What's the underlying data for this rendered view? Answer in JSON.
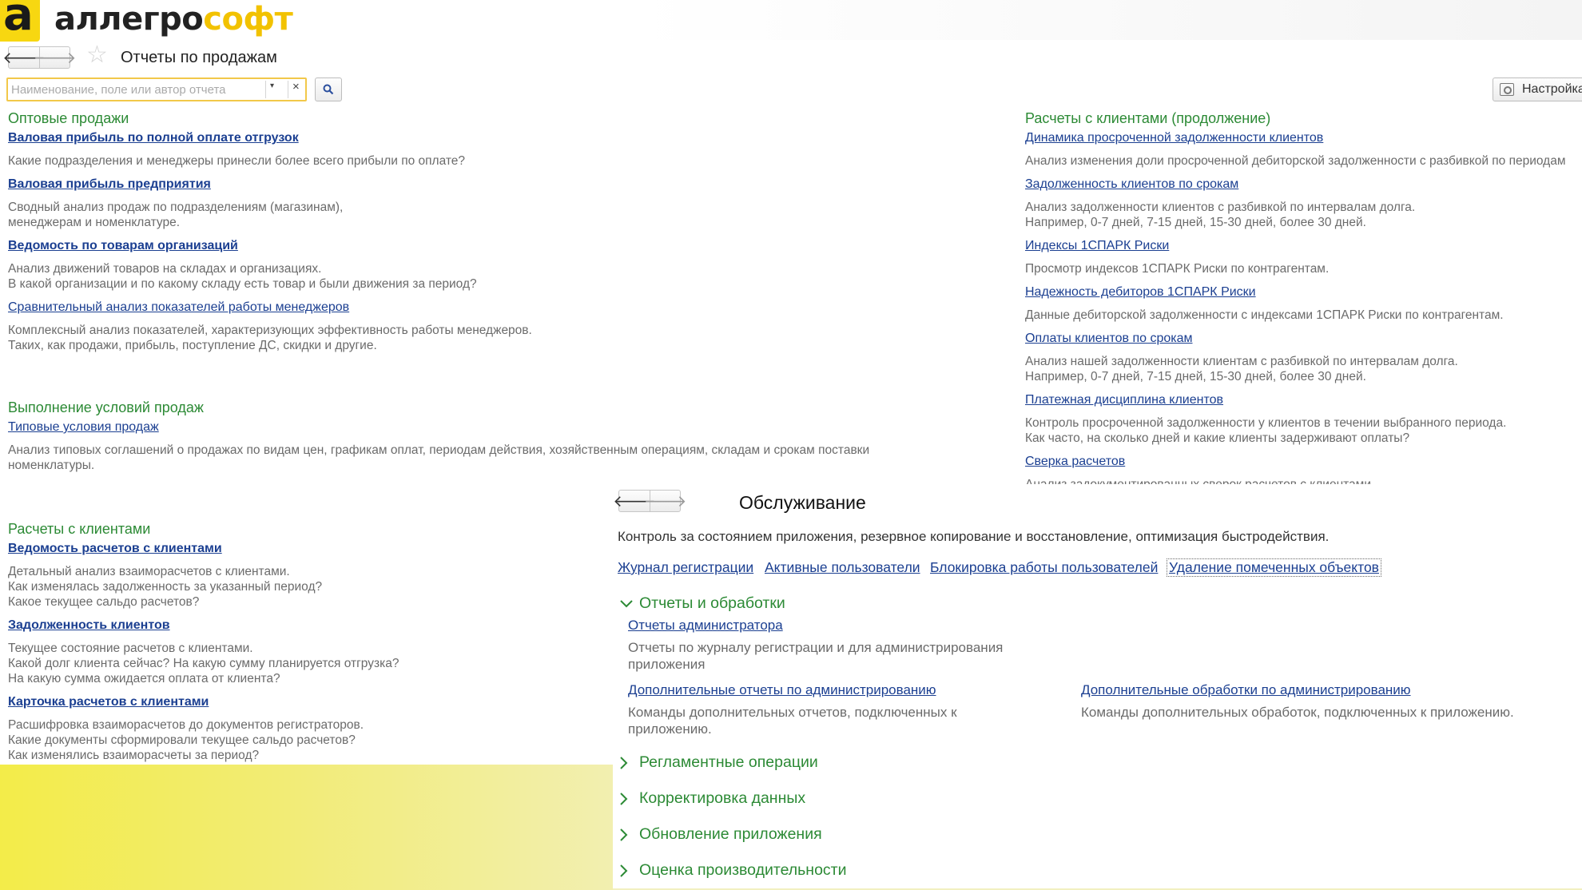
{
  "logo": {
    "mark": "а",
    "text_dark": "аллегро",
    "text_yellow": "софт"
  },
  "header": {
    "title": "Отчеты по продажам",
    "back_glyph": "🡐",
    "forward_glyph": "🡒",
    "star_glyph": "☆"
  },
  "search": {
    "placeholder": "Наименование, поле или автор отчета",
    "value": "",
    "dropdown_glyph": "▾",
    "clear_glyph": "×",
    "settings_label": "Настройка"
  },
  "sections": {
    "wholesale": {
      "heading": "Оптовые продажи",
      "items": [
        {
          "label": "Валовая прибыль по полной оплате отгрузок",
          "desc": [
            "Какие подразделения и менеджеры принесли более всего прибыли по оплате?"
          ]
        },
        {
          "label": "Валовая прибыль предприятия",
          "desc": [
            "Сводный анализ продаж по подразделениям (магазинам),",
            "менеджерам и номенклатуре."
          ]
        },
        {
          "label": "Ведомость по товарам организаций",
          "desc": [
            "Анализ движений товаров на складах и организациях.",
            "В какой организации и по какому складу есть товар и были движения за период?"
          ]
        },
        {
          "label": "Сравнительный анализ показателей работы менеджеров",
          "desc": [
            "Комплексный анализ показателей, характеризующих эффективность работы менеджеров.",
            "Таких, как продажи, прибыль, поступление ДС, скидки и другие."
          ]
        }
      ]
    },
    "conditions": {
      "heading": "Выполнение условий продаж",
      "items": [
        {
          "label": "Типовые условия продаж",
          "desc": [
            "Анализ типовых соглашений о продажах по видам цен, графикам оплат, периодам действия, хозяйственным операциям, складам и срокам поставки",
            "номенклатуры."
          ]
        }
      ]
    },
    "clients": {
      "heading": "Расчеты с клиентами",
      "items": [
        {
          "label": "Ведомость расчетов с клиентами",
          "desc": [
            "Детальный анализ взаиморасчетов с клиентами.",
            "Как изменялась задолженность за указанный период?",
            "Какое текущее сальдо расчетов?"
          ]
        },
        {
          "label": "Задолженность клиентов",
          "desc": [
            "Текущее состояние расчетов с клиентами.",
            "Какой долг клиента сейчас? На какую сумму планируется отгрузка?",
            "На какую сумма ожидается оплата от клиента?"
          ]
        },
        {
          "label": "Карточка расчетов с клиентами",
          "desc": [
            "Расшифровка взаиморасчетов до документов регистраторов.",
            "Какие документы сформировали текущее сальдо расчетов?",
            "Как изменялись взаиморасчеты за период?"
          ]
        }
      ]
    },
    "clients_cont": {
      "heading": "Расчеты с клиентами (продолжение)",
      "items": [
        {
          "label": "Динамика просроченной задолженности клиентов",
          "desc": [
            "Анализ изменения доли просроченной дебиторской задолженности с разбивкой по периодам"
          ]
        },
        {
          "label": "Задолженность клиентов по срокам",
          "desc": [
            "Анализ задолженности клиентов с разбивкой по интервалам долга.",
            "Например, 0-7 дней, 7-15 дней, 15-30 дней, более 30 дней."
          ]
        },
        {
          "label": "Индексы 1СПАРК Риски",
          "desc": [
            "Просмотр индексов 1СПАРК Риски по контрагентам."
          ]
        },
        {
          "label": "Надежность дебиторов 1СПАРК Риски",
          "desc": [
            "Данные дебиторской задолженности с индексами 1СПАРК Риски по контрагентам."
          ]
        },
        {
          "label": "Оплаты клиентов по срокам",
          "desc": [
            "Анализ нашей задолженности клиентам с разбивкой по интервалам долга.",
            "Например, 0-7 дней, 7-15 дней, 15-30 дней, более 30 дней."
          ]
        },
        {
          "label": "Платежная дисциплина клиентов",
          "desc": [
            "Контроль просроченной задолженности у клиентов в течении выбранного периода.",
            "Как часто, на сколько дней и какие клиенты задерживают оплаты?"
          ]
        },
        {
          "label": "Сверка расчетов",
          "desc": [
            "Анализ задокументированных сверок расчетов с клиентами"
          ]
        }
      ]
    }
  },
  "service": {
    "title": "Обслуживание",
    "description": "Контроль за состоянием приложения, резервное копирование и восстановление, оптимизация быстродействия.",
    "links": [
      "Журнал регистрации",
      "Активные пользователи",
      "Блокировка работы пользователей",
      "Удаление помеченных объектов"
    ],
    "reports_group": {
      "heading": "Отчеты и обработки",
      "items": [
        {
          "label": "Отчеты администратора",
          "desc": [
            "Отчеты по журналу регистрации и для администрирования",
            "приложения"
          ]
        },
        {
          "label": "Дополнительные отчеты по администрированию",
          "desc": [
            "Команды дополнительных отчетов, подключенных к",
            "приложению."
          ]
        },
        {
          "label": "Дополнительные обработки по администрированию",
          "desc": [
            "Команды дополнительных обработок, подключенных к приложению."
          ]
        }
      ]
    },
    "collapsed_groups": [
      "Регламентные операции",
      "Корректировка данных",
      "Обновление приложения",
      "Оценка производительности"
    ],
    "expanded_chevron": "﹀",
    "collapsed_chevron": "›"
  }
}
